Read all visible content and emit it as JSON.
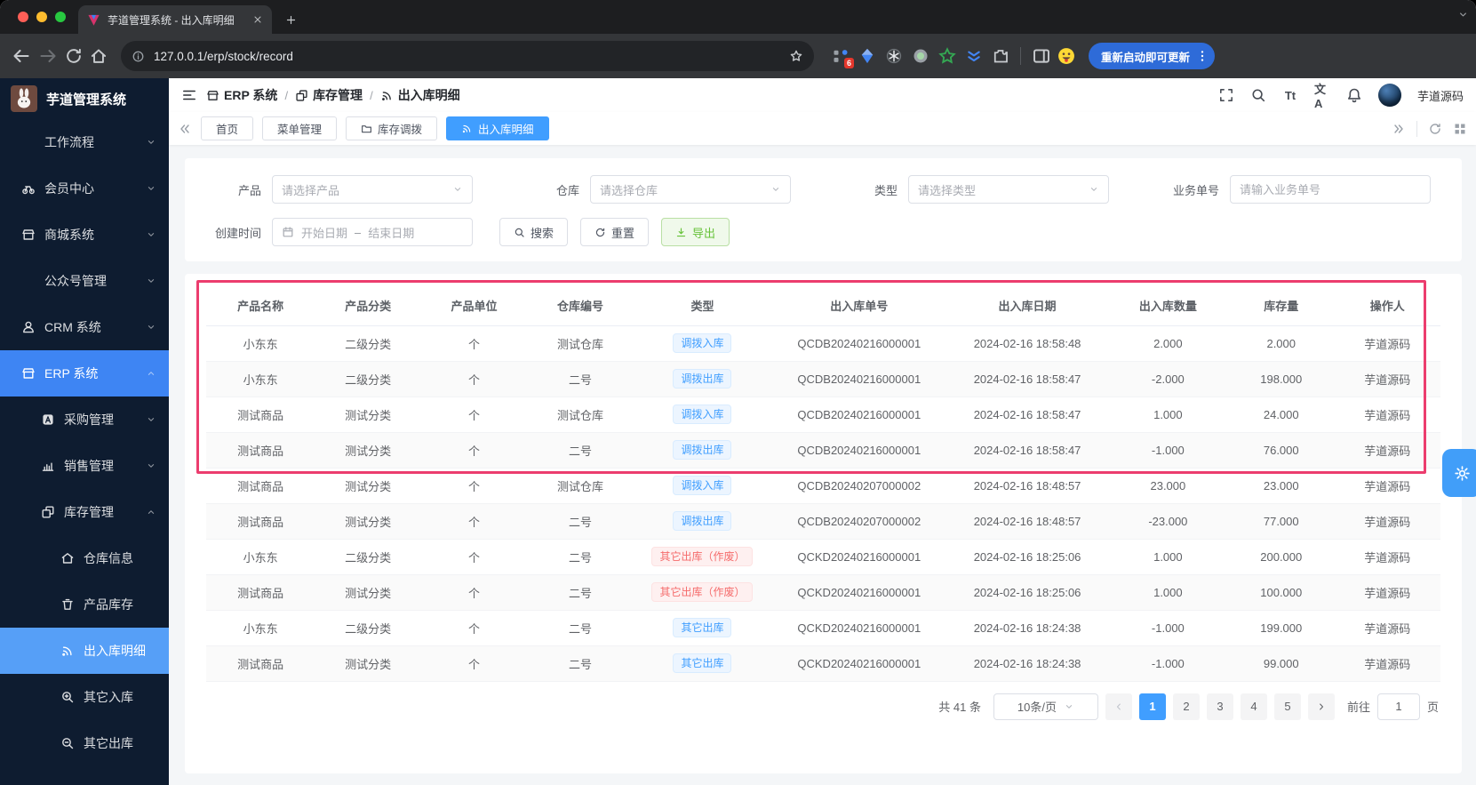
{
  "colors": {
    "accent": "#409eff",
    "sidebar_bg": "#0e1c30",
    "annotation_pink": "#ec3d6e",
    "tag_blue_text": "#409eff",
    "tag_red_text": "#f56c6c",
    "export_green": "#67c23a"
  },
  "browser": {
    "tab_title": "芋道管理系统 - 出入库明细",
    "url": "127.0.0.1/erp/stock/record",
    "update_button": "重新启动即可更新",
    "extension_badge": "6"
  },
  "sidebar": {
    "logo_title": "芋道管理系统",
    "items": [
      {
        "label": "工作流程",
        "icon": "",
        "level": 1,
        "chevron": "down",
        "active": false
      },
      {
        "label": "会员中心",
        "icon": "member-icon",
        "level": 1,
        "chevron": "down",
        "active": false
      },
      {
        "label": "商城系统",
        "icon": "mall-icon",
        "level": 1,
        "chevron": "down",
        "active": false
      },
      {
        "label": "公众号管理",
        "icon": "",
        "level": 1,
        "chevron": "down",
        "active": false
      },
      {
        "label": "CRM 系统",
        "icon": "user-icon",
        "level": 1,
        "chevron": "down",
        "active": false
      },
      {
        "label": "ERP 系统",
        "icon": "store-icon",
        "level": 1,
        "chevron": "up",
        "active": true
      },
      {
        "label": "采购管理",
        "icon": "purchase-icon",
        "level": 2,
        "chevron": "down",
        "active": false
      },
      {
        "label": "销售管理",
        "icon": "sales-icon",
        "level": 2,
        "chevron": "down",
        "active": false
      },
      {
        "label": "库存管理",
        "icon": "stock-icon",
        "level": 2,
        "chevron": "up",
        "active": false
      },
      {
        "label": "仓库信息",
        "icon": "warehouse-icon",
        "level": 3,
        "chevron": "",
        "active": false
      },
      {
        "label": "产品库存",
        "icon": "product-icon",
        "level": 3,
        "chevron": "",
        "active": false
      },
      {
        "label": "出入库明细",
        "icon": "record-icon",
        "level": 3,
        "chevron": "",
        "active": true
      },
      {
        "label": "其它入库",
        "icon": "zoom-in-icon",
        "level": 3,
        "chevron": "",
        "active": false
      },
      {
        "label": "其它出库",
        "icon": "zoom-out-icon",
        "level": 3,
        "chevron": "",
        "active": false
      }
    ]
  },
  "header": {
    "breadcrumb": [
      {
        "label": "ERP 系统",
        "icon": "store-icon"
      },
      {
        "label": "库存管理",
        "icon": "stock-icon"
      },
      {
        "label": "出入库明细",
        "icon": "record-icon"
      }
    ],
    "breadcrumb_separator": "/",
    "font_size_icon_label": "Tt",
    "translate_icon_label": "文A",
    "username": "芋道源码"
  },
  "tabbar": {
    "tabs": [
      {
        "label": "首页",
        "icon": "",
        "active": false
      },
      {
        "label": "菜单管理",
        "icon": "",
        "active": false
      },
      {
        "label": "库存调拨",
        "icon": "folder-icon",
        "active": false
      },
      {
        "label": "出入库明细",
        "icon": "record-icon",
        "active": true
      }
    ]
  },
  "filters": {
    "product_label": "产品",
    "product_placeholder": "请选择产品",
    "warehouse_label": "仓库",
    "warehouse_placeholder": "请选择仓库",
    "type_label": "类型",
    "type_placeholder": "请选择类型",
    "biz_no_label": "业务单号",
    "biz_no_placeholder": "请输入业务单号",
    "create_time_label": "创建时间",
    "date_start_placeholder": "开始日期",
    "date_separator": "–",
    "date_end_placeholder": "结束日期",
    "search_button": "搜索",
    "reset_button": "重置",
    "export_button": "导出"
  },
  "table": {
    "columns": [
      "产品名称",
      "产品分类",
      "产品单位",
      "仓库编号",
      "类型",
      "出入库单号",
      "出入库日期",
      "出入库数量",
      "库存量",
      "操作人"
    ],
    "rows": [
      {
        "cells": [
          "小东东",
          "二级分类",
          "个",
          "测试仓库",
          "调拨入库",
          "QCDB20240216000001",
          "2024-02-16 18:58:48",
          "2.000",
          "2.000",
          "芋道源码"
        ],
        "tag_color": "blue"
      },
      {
        "cells": [
          "小东东",
          "二级分类",
          "个",
          "二号",
          "调拨出库",
          "QCDB20240216000001",
          "2024-02-16 18:58:47",
          "-2.000",
          "198.000",
          "芋道源码"
        ],
        "tag_color": "blue"
      },
      {
        "cells": [
          "测试商品",
          "测试分类",
          "个",
          "测试仓库",
          "调拨入库",
          "QCDB20240216000001",
          "2024-02-16 18:58:47",
          "1.000",
          "24.000",
          "芋道源码"
        ],
        "tag_color": "blue"
      },
      {
        "cells": [
          "测试商品",
          "测试分类",
          "个",
          "二号",
          "调拨出库",
          "QCDB20240216000001",
          "2024-02-16 18:58:47",
          "-1.000",
          "76.000",
          "芋道源码"
        ],
        "tag_color": "blue"
      },
      {
        "cells": [
          "测试商品",
          "测试分类",
          "个",
          "测试仓库",
          "调拨入库",
          "QCDB20240207000002",
          "2024-02-16 18:48:57",
          "23.000",
          "23.000",
          "芋道源码"
        ],
        "tag_color": "blue"
      },
      {
        "cells": [
          "测试商品",
          "测试分类",
          "个",
          "二号",
          "调拨出库",
          "QCDB20240207000002",
          "2024-02-16 18:48:57",
          "-23.000",
          "77.000",
          "芋道源码"
        ],
        "tag_color": "blue"
      },
      {
        "cells": [
          "小东东",
          "二级分类",
          "个",
          "二号",
          "其它出库（作废）",
          "QCKD20240216000001",
          "2024-02-16 18:25:06",
          "1.000",
          "200.000",
          "芋道源码"
        ],
        "tag_color": "red"
      },
      {
        "cells": [
          "测试商品",
          "测试分类",
          "个",
          "二号",
          "其它出库（作废）",
          "QCKD20240216000001",
          "2024-02-16 18:25:06",
          "1.000",
          "100.000",
          "芋道源码"
        ],
        "tag_color": "red"
      },
      {
        "cells": [
          "小东东",
          "二级分类",
          "个",
          "二号",
          "其它出库",
          "QCKD20240216000001",
          "2024-02-16 18:24:38",
          "-1.000",
          "199.000",
          "芋道源码"
        ],
        "tag_color": "blue"
      },
      {
        "cells": [
          "测试商品",
          "测试分类",
          "个",
          "二号",
          "其它出库",
          "QCKD20240216000001",
          "2024-02-16 18:24:38",
          "-1.000",
          "99.000",
          "芋道源码"
        ],
        "tag_color": "blue"
      }
    ]
  },
  "pagination": {
    "total": "共 41 条",
    "page_size": "10条/页",
    "pages": [
      "1",
      "2",
      "3",
      "4",
      "5"
    ],
    "active_page": "1",
    "goto_label": "前往",
    "goto_value": "1",
    "unit_label": "页"
  }
}
